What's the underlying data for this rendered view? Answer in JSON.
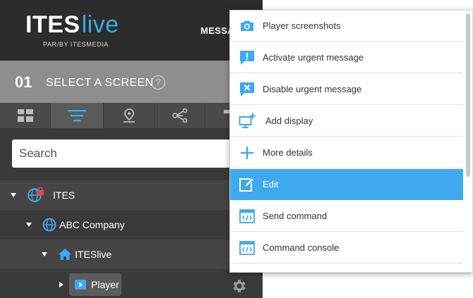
{
  "header": {
    "logo_part1": "ITES",
    "logo_part2": "live",
    "logo_sub": "PAR/BY ITESMEDIA",
    "nav_partial": "MESSA"
  },
  "colors": {
    "accent": "#3ea9ef",
    "sidebar_bg": "#3a3a3a",
    "step_bar_bg": "#8e8e8e"
  },
  "step": {
    "number": "01",
    "title": "SELECT A SCREEN",
    "help": "?"
  },
  "tabs": [
    {
      "icon": "grid-icon",
      "active": false
    },
    {
      "icon": "filter-list-icon",
      "active": true
    },
    {
      "icon": "map-pin-icon",
      "active": false
    },
    {
      "icon": "share-nodes-icon",
      "active": false
    },
    {
      "icon": "partial-icon",
      "active": false
    }
  ],
  "search": {
    "placeholder": "Search",
    "value": ""
  },
  "tree": [
    {
      "label": "ITES",
      "icon": "globe-lock-icon",
      "expanded": true,
      "depth": 0
    },
    {
      "label": "ABC Company",
      "icon": "globe-icon",
      "expanded": true,
      "depth": 1
    },
    {
      "label": "ITESlive",
      "icon": "home-icon",
      "expanded": true,
      "depth": 2
    },
    {
      "label": "Player",
      "icon": "player-icon",
      "expanded": false,
      "depth": 3
    }
  ],
  "menu": {
    "items": [
      {
        "label": "Player screenshots",
        "icon": "camera-icon",
        "active": false
      },
      {
        "label": "Activate urgent message",
        "icon": "urgent-message-icon",
        "active": false
      },
      {
        "label": "Disable urgent message",
        "icon": "disable-message-icon",
        "active": false
      },
      {
        "label": "Add display",
        "icon": "add-display-icon",
        "active": false
      },
      {
        "label": "More details",
        "icon": "plus-icon",
        "active": false
      },
      {
        "label": "Edit",
        "icon": "edit-icon",
        "active": true
      },
      {
        "label": "Send command",
        "icon": "command-window-icon",
        "active": false
      },
      {
        "label": "Command console",
        "icon": "console-window-icon",
        "active": false
      }
    ]
  }
}
